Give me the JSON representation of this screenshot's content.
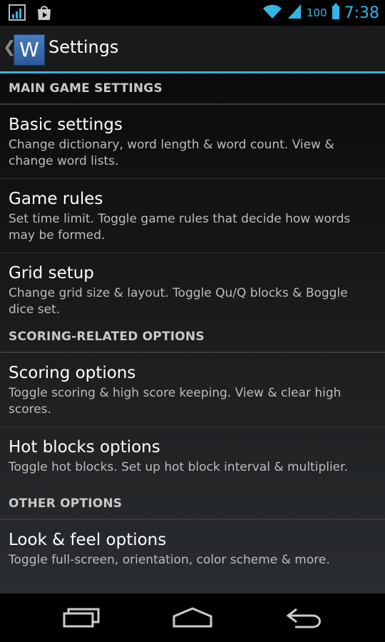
{
  "status_bar": {
    "icons": [
      "signal-chart-notification-icon",
      "play-store-notification-icon",
      "wifi-icon",
      "cell-signal-icon",
      "battery-icon"
    ],
    "battery": "100",
    "time": "7:38",
    "accent_color": "#33b5e5"
  },
  "action_bar": {
    "logo_letter": "W",
    "title": "Settings"
  },
  "sections": [
    {
      "header": "MAIN GAME SETTINGS",
      "items": [
        {
          "title": "Basic settings",
          "summary": "Change dictionary, word length & word count. View & change word lists."
        },
        {
          "title": "Game rules",
          "summary": "Set time limit. Toggle game rules that decide how words may be formed."
        },
        {
          "title": "Grid setup",
          "summary": "Change grid size & layout. Toggle Qu/Q blocks & Boggle dice set."
        }
      ]
    },
    {
      "header": "SCORING-RELATED OPTIONS",
      "items": [
        {
          "title": "Scoring options",
          "summary": "Toggle scoring & high score keeping. View & clear high scores."
        },
        {
          "title": "Hot blocks options",
          "summary": "Toggle hot blocks. Set up hot block interval & multiplier."
        }
      ]
    },
    {
      "header": "OTHER OPTIONS",
      "items": [
        {
          "title": "Look & feel options",
          "summary": "Toggle full-screen, orientation, color scheme & more."
        }
      ]
    }
  ],
  "nav_bar": {
    "buttons": [
      "recent-apps-icon",
      "home-icon",
      "back-icon"
    ]
  }
}
